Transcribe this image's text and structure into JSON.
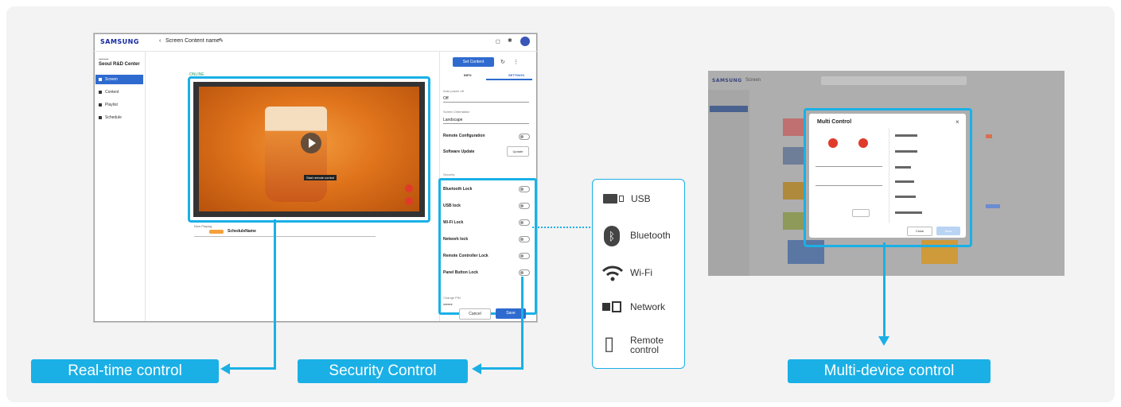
{
  "colors": {
    "accent": "#1ab0e6",
    "primary_button": "#2f6bcf",
    "orange": "#e06a12"
  },
  "screen1": {
    "logo": "SAMSUNG",
    "breadcrumb": "Screen Content name",
    "workspace": "Seoul R&D Center",
    "nav": [
      "Screen",
      "Content",
      "Playlist",
      "Schedule"
    ],
    "preview_label": "ONLINE",
    "now_playing_label": "Now Playing",
    "schedule_name": "ScheduleName",
    "overlay_text": "Start remote control",
    "top_button": "Set Content",
    "tabs": [
      "INFO",
      "SETTINGS"
    ],
    "settings": {
      "option1_label": "Auto power off",
      "option1_value": "Off",
      "option2_label": "Screen Orientation",
      "option2_value": "Landscape",
      "remote_config": "Remote Configuration",
      "software_update": "Software Update",
      "update_button": "Update",
      "security_heading": "Security",
      "security_items": [
        "Bluetooth Lock",
        "USB lock",
        "Wi-Fi Lock",
        "Network lock",
        "Remote Controller Lock",
        "Panel Button Lock"
      ],
      "change_pin": "Change PIN",
      "pin_value": "******",
      "cancel": "Cancel",
      "save": "Save"
    }
  },
  "iconbox": [
    {
      "icon": "usb-icon",
      "label": "USB"
    },
    {
      "icon": "bluetooth-icon",
      "label": "Bluetooth"
    },
    {
      "icon": "wifi-icon",
      "label": "Wi-Fi"
    },
    {
      "icon": "network-icon",
      "label": "Network"
    },
    {
      "icon": "remote-control-icon",
      "label": "Remote control"
    }
  ],
  "screen3": {
    "logo": "SAMSUNG",
    "title": "Screen",
    "modal_title": "Multi Control",
    "modal_buttons": [
      "Close",
      "Save"
    ]
  },
  "callouts": {
    "realtime": "Real-time control",
    "security": "Security Control",
    "multi": "Multi-device control"
  }
}
